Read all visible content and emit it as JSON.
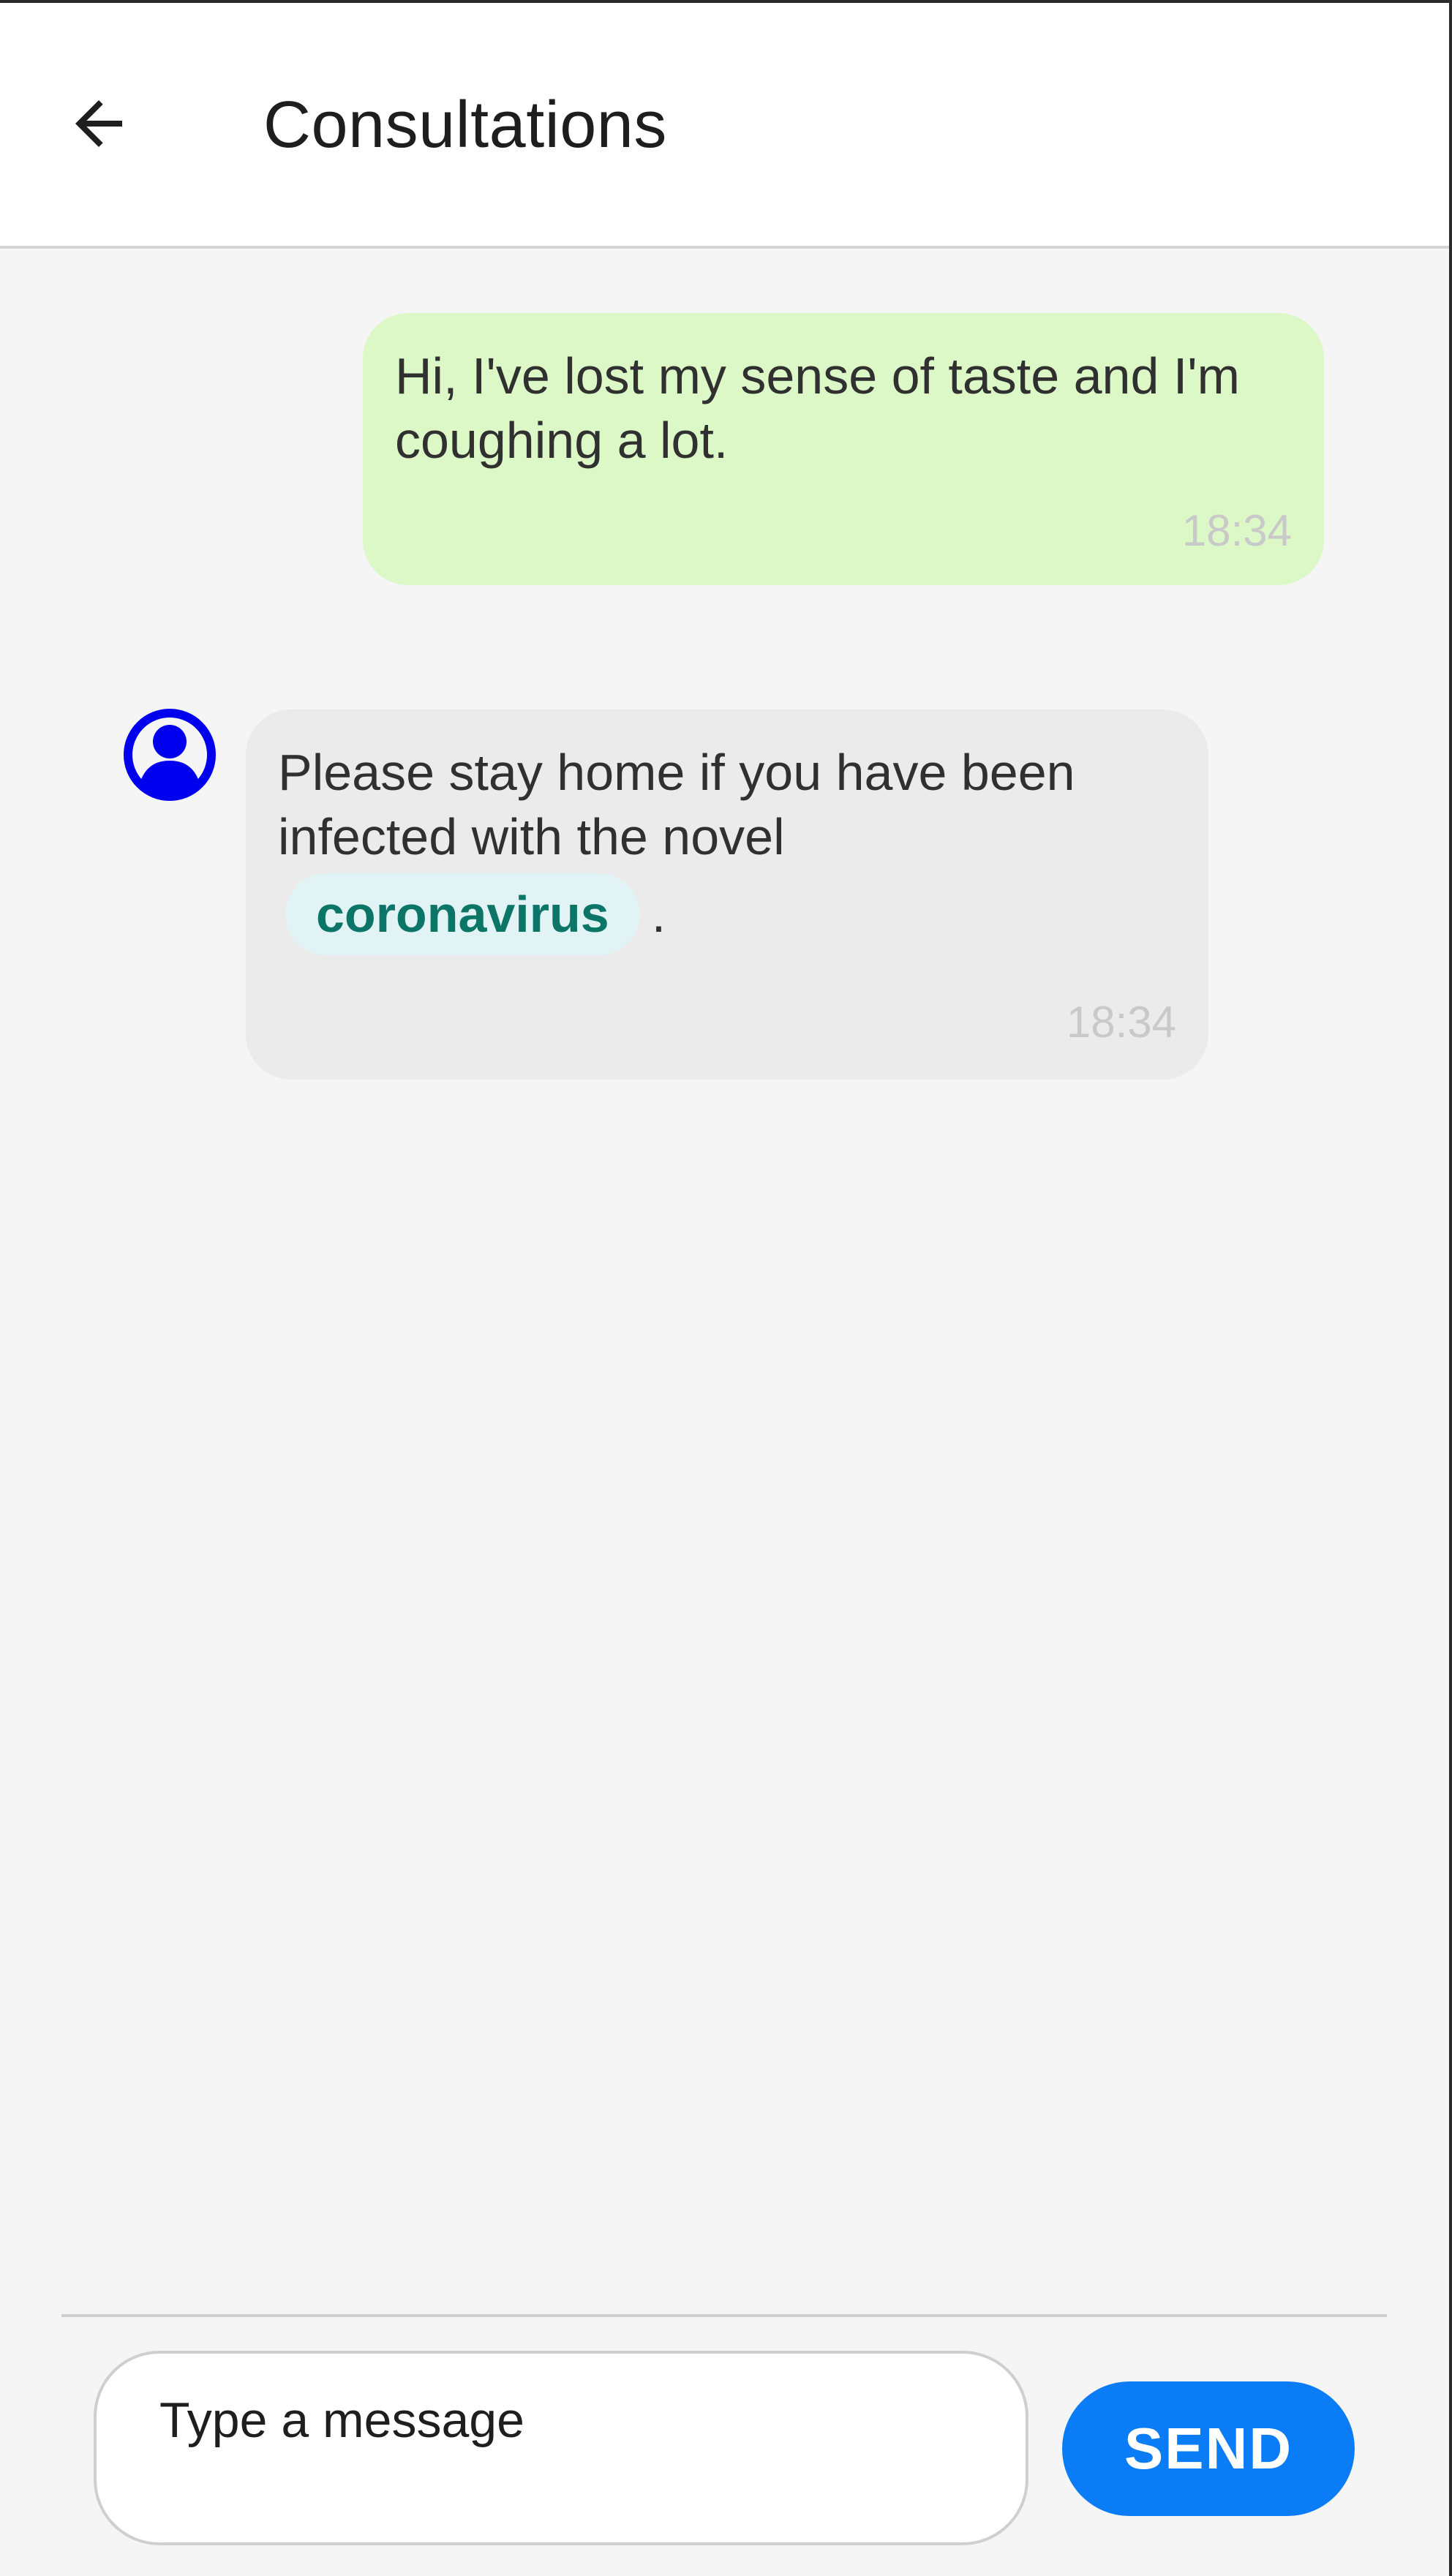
{
  "header": {
    "back_icon": "arrow-left-icon",
    "title": "Consultations"
  },
  "messages": [
    {
      "direction": "outgoing",
      "text": "Hi, I've lost my sense of taste and I'm coughing a lot.",
      "time": "18:34",
      "color": "#dcf8c6"
    },
    {
      "direction": "incoming",
      "avatar_icon": "user-avatar-icon",
      "text": "Please stay home if you have been infected with the novel",
      "chip": "coronavirus",
      "after_chip": ".",
      "time": "18:34",
      "color": "#ebebeb"
    }
  ],
  "composer": {
    "placeholder": "Type a message",
    "value": "",
    "send_label": "SEND"
  },
  "colors": {
    "accent": "#0a7cf5",
    "avatar": "#0000ee",
    "chip_text": "#0b7667",
    "chip_bg": "#e1f3f4"
  }
}
